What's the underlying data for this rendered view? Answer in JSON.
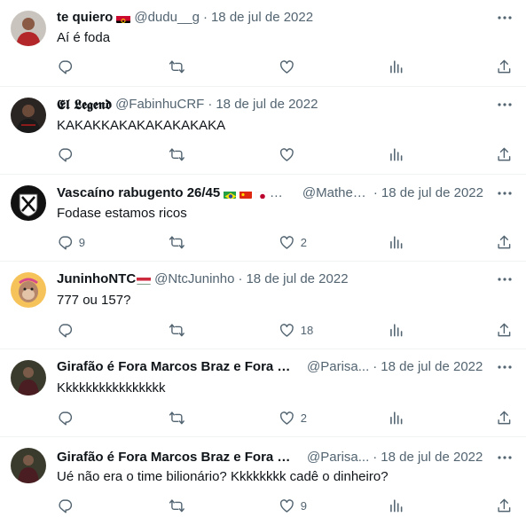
{
  "separator": "·",
  "tweets": [
    {
      "display_name": "te quiero",
      "flags": [
        "angola-flag"
      ],
      "handle": "@dudu__g",
      "date": "18 de jul de 2022",
      "text": "Aí é foda",
      "reply_count": "",
      "retweet_count": "",
      "like_count": "",
      "avatar": "person-red-shirt"
    },
    {
      "display_name": "𝕰𝖑 𝕷𝖊𝖌𝖊𝖓𝖉",
      "flags": [],
      "handle": "@FabinhuCRF",
      "date": "18 de jul de 2022",
      "text": "KAKAKKAKAKAKAKAKAKA",
      "reply_count": "",
      "retweet_count": "",
      "like_count": "",
      "avatar": "player-dark"
    },
    {
      "display_name": "Vascaíno rabugento 26/45",
      "flags": [
        "brazil-flag",
        "china-flag",
        "japan-flag"
      ],
      "handle": "@MatheusBandeira",
      "handle_shown": "@Matheus…",
      "date": "18 de jul de 2022",
      "text": "Fodase estamos ricos",
      "reply_count": "9",
      "retweet_count": "",
      "like_count": "2",
      "avatar": "vasco-crest"
    },
    {
      "display_name": "JuninhoNTC",
      "flags": [
        "hungary-flag"
      ],
      "handle": "@NtcJuninho",
      "date": "18 de jul de 2022",
      "text": "777 ou 157?",
      "reply_count": "",
      "retweet_count": "",
      "like_count": "18",
      "avatar": "cartoon-ape"
    },
    {
      "display_name": "Girafão é Fora Marcos Braz e Fora La...",
      "flags": [],
      "handle": "@Parisa...",
      "date": "18 de jul de 2022",
      "text": "Kkkkkkkkkkkkkkkk",
      "reply_count": "",
      "retweet_count": "",
      "like_count": "2",
      "avatar": "person-dark-red"
    },
    {
      "display_name": "Girafão é Fora Marcos Braz e Fora La...",
      "flags": [],
      "handle": "@Parisa...",
      "date": "18 de jul de 2022",
      "text": "Ué não era o time bilionário? Kkkkkkkk cadê o dinheiro?",
      "reply_count": "",
      "retweet_count": "",
      "like_count": "9",
      "avatar": "person-dark-red"
    }
  ],
  "colors": {
    "text_primary": "#0f1419",
    "text_secondary": "#536471",
    "divider": "#eff3f4"
  },
  "icons": [
    "reply-icon",
    "retweet-icon",
    "like-icon",
    "views-icon",
    "share-icon",
    "more-icon"
  ]
}
